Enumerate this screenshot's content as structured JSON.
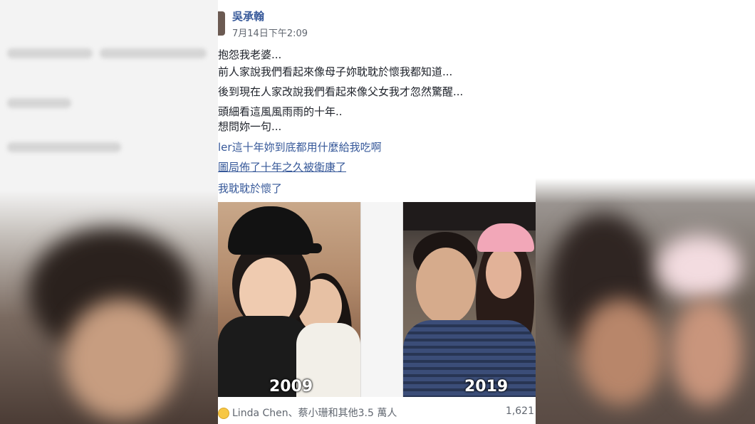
{
  "post": {
    "author": "吳承翰",
    "timestamp": "7月14日下午2:09",
    "lines": [
      "抱怨我老婆...",
      "前人家說我們看起來像母子妳耽耽於懷我都知道...",
      "後到現在人家改說我們看起來像父女我才忽然驚醒...",
      "頭細看這風風雨雨的十年..",
      "想問妳一句..."
    ],
    "link_lines": [
      "ler這十年妳到底都用什麼給我吃啊",
      "圖局佈了十年之久被衛康了",
      "我耽耽於懷了"
    ],
    "photos": [
      {
        "year": "2009"
      },
      {
        "year": "2019"
      }
    ],
    "reactions": {
      "text": "Linda Chen、蔡小珊和其他3.5 萬人",
      "comment_count": "1,621"
    }
  },
  "colors": {
    "link": "#365899",
    "meta": "#616770",
    "text": "#1d2129"
  }
}
